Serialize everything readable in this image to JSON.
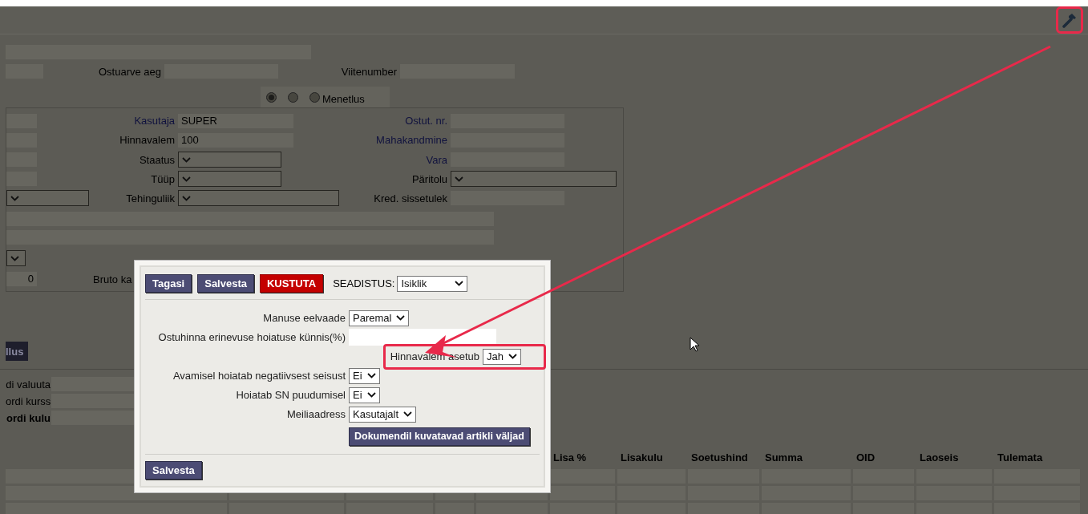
{
  "toolbar": {
    "tool_button": {
      "highlighted": true
    }
  },
  "header_row": {
    "labels": [
      "Ostuarve aeg",
      "Viitenumber"
    ]
  },
  "mode_radios": [
    {
      "selected": true
    },
    {
      "selected": false
    },
    {
      "label": "Menetlus",
      "selected": false
    }
  ],
  "panel_rows": [
    {
      "left": {
        "kind": "field"
      },
      "middle": {
        "label": "Kasutaja",
        "linked": true,
        "kind": "field",
        "value": "SUPER"
      },
      "right": {
        "label": "Ostut. nr.",
        "linked": true,
        "kind": "field"
      }
    },
    {
      "left": {
        "kind": "field"
      },
      "middle": {
        "label": "Hinnavalem",
        "linked": false,
        "kind": "field",
        "value": "100"
      },
      "right": {
        "label": "Mahakandmine",
        "linked": true,
        "kind": "field"
      }
    },
    {
      "left": {
        "kind": "field"
      },
      "middle": {
        "label": "Staatus",
        "linked": false,
        "kind": "select"
      },
      "right": {
        "label": "Vara",
        "linked": true,
        "kind": "field"
      }
    },
    {
      "left": {
        "kind": "field"
      },
      "middle": {
        "label": "Tüüp",
        "linked": false,
        "kind": "select"
      },
      "right": {
        "label": "Päritolu",
        "linked": false,
        "kind": "select"
      }
    },
    {
      "left": {
        "kind": "select"
      },
      "middle": {
        "label": "Tehinguliik",
        "linked": false,
        "kind": "select"
      },
      "right": {
        "label": "Kred. sissetulek",
        "linked": false,
        "kind": "field"
      }
    }
  ],
  "amount_row": {
    "value": "0",
    "label": "Bruto ka"
  },
  "side_button": "llus",
  "currency_rows": [
    {
      "label": "di valuuta",
      "bold": false
    },
    {
      "label": "ordi kurss",
      "bold": false
    },
    {
      "label": "ordi kulu",
      "bold": true
    }
  ],
  "table": {
    "columns": [
      "Lisa %",
      "Lisakulu",
      "Soetushind",
      "Summa",
      "OID",
      "Laoseis",
      "Tulemata"
    ]
  },
  "dialog": {
    "buttons": [
      {
        "label": "Tagasi",
        "kind": "primary"
      },
      {
        "label": "Salvesta",
        "kind": "primary"
      },
      {
        "label": "KUSTUTA",
        "kind": "danger"
      }
    ],
    "setting": {
      "label": "SEADISTUS:",
      "value": "Isiklik"
    },
    "rows": [
      {
        "label": "Manuse eelvaade",
        "kind": "select",
        "value": "Paremal",
        "highlighted": false
      },
      {
        "label": "Ostuhinna erinevuse hoiatuse künnis(%)",
        "kind": "input",
        "highlighted": false
      },
      {
        "label": "Hinnavalem asetub",
        "kind": "select",
        "value": "Jah",
        "highlighted": true
      },
      {
        "label": "Avamisel hoiatab negatiivsest seisust",
        "kind": "select",
        "value": "Ei",
        "highlighted": false
      },
      {
        "label": "Hoiatab SN puudumisel",
        "kind": "select",
        "value": "Ei",
        "highlighted": false
      },
      {
        "label": "Meiliaadress",
        "kind": "select",
        "value": "Kasutajalt",
        "highlighted": false
      }
    ],
    "action_button": "Dokumendil kuvatavad artikli väljad",
    "footer_button": "Salvesta"
  }
}
